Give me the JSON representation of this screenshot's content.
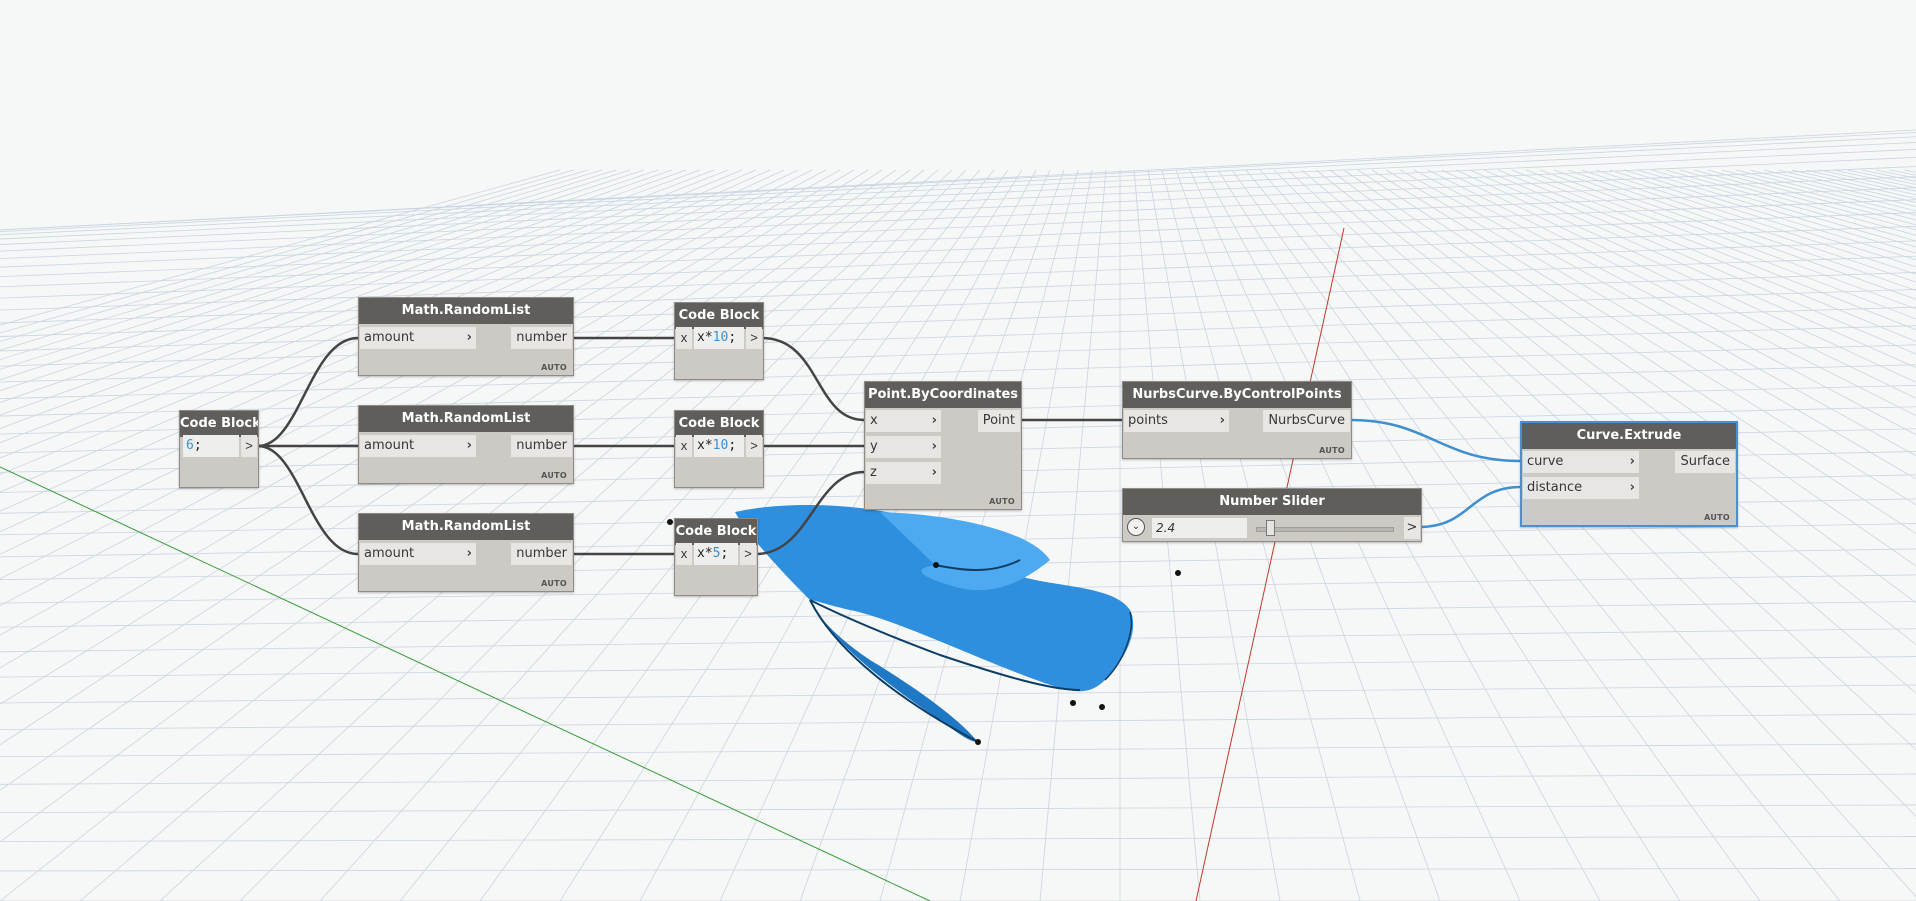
{
  "canvas": {
    "background": "#f6f7f7",
    "grid_color": "#c7d4e0",
    "axis_x_color": "#c0392b",
    "axis_y_color": "#3a9a3a",
    "geometry_color": "#2f8fe0"
  },
  "nodes": {
    "code_block_6": {
      "title": "Code Block",
      "code": "6",
      "semicolon": ";",
      "out": ">"
    },
    "random_list_1": {
      "title": "Math.RandomList",
      "input": "amount",
      "output": "number",
      "run_mode": "AUTO"
    },
    "random_list_2": {
      "title": "Math.RandomList",
      "input": "amount",
      "output": "number",
      "run_mode": "AUTO"
    },
    "random_list_3": {
      "title": "Math.RandomList",
      "input": "amount",
      "output": "number",
      "run_mode": "AUTO"
    },
    "code_block_x10_a": {
      "title": "Code Block",
      "input": "x",
      "code_prefix": "x*",
      "code_num": "10",
      "semicolon": ";",
      "out": ">"
    },
    "code_block_x10_b": {
      "title": "Code Block",
      "input": "x",
      "code_prefix": "x*",
      "code_num": "10",
      "semicolon": ";",
      "out": ">"
    },
    "code_block_x5": {
      "title": "Code Block",
      "input": "x",
      "code_prefix": "x*",
      "code_num": "5",
      "semicolon": ";",
      "out": ">"
    },
    "point_by_coordinates": {
      "title": "Point.ByCoordinates",
      "inputs": [
        "x",
        "y",
        "z"
      ],
      "output": "Point",
      "run_mode": "AUTO"
    },
    "nurbs_curve": {
      "title": "NurbsCurve.ByControlPoints",
      "input": "points",
      "output": "NurbsCurve",
      "run_mode": "AUTO"
    },
    "number_slider": {
      "title": "Number Slider",
      "value": "2.4",
      "fraction": 0.1,
      "out": ">"
    },
    "curve_extrude": {
      "title": "Curve.Extrude",
      "inputs": [
        "curve",
        "distance"
      ],
      "output": "Surface",
      "run_mode": "AUTO"
    }
  }
}
